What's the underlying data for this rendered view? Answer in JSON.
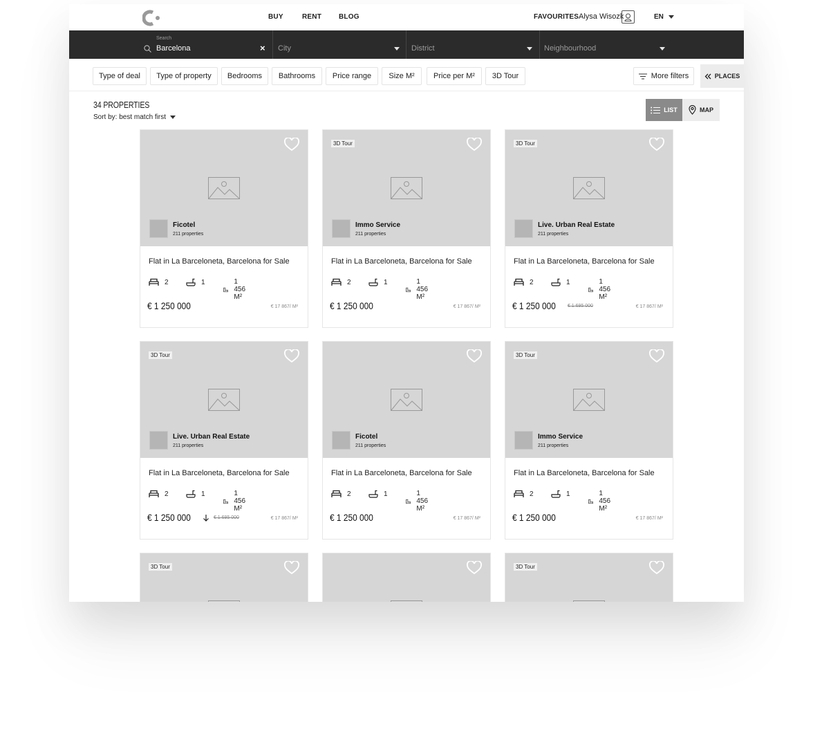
{
  "nav": {
    "links": [
      "BUY",
      "RENT",
      "BLOG"
    ],
    "favourites": "FAVOURITES",
    "user_name": "Alysa Wisozk",
    "language": "EN"
  },
  "search": {
    "label": "Search",
    "value": "Barcelona",
    "city_placeholder": "City",
    "district_placeholder": "District",
    "neighbourhood_placeholder": "Neighbourhood"
  },
  "filters": {
    "items": [
      "Type of deal",
      "Type of property",
      "Bedrooms",
      "Bathrooms",
      "Price range",
      "Size  M²",
      "Price per M²",
      "3D Tour"
    ],
    "more": "More filters",
    "places": "PLACES"
  },
  "results": {
    "count": "34 PROPERTIES",
    "sort": "Sort by: best match first",
    "list_label": "LIST",
    "map_label": "MAP"
  },
  "cards": [
    {
      "tour": "",
      "agency": "Ficotel",
      "agency_count": "211 properties",
      "title": "Flat in La Barceloneta, Barcelona for Sale",
      "beds": "2",
      "baths": "1",
      "size": "1 456 M²",
      "price": "€ 1 250 000",
      "old_price": "",
      "drop": false,
      "ppm": "€ 17 867/ M²"
    },
    {
      "tour": "3D Tour",
      "agency": "Immo Service",
      "agency_count": "211 properties",
      "title": "Flat in La Barceloneta, Barcelona for Sale",
      "beds": "2",
      "baths": "1",
      "size": "1 456 M²",
      "price": "€ 1 250 000",
      "old_price": "",
      "drop": false,
      "ppm": "€ 17 867/ M²"
    },
    {
      "tour": "3D Tour",
      "agency": "Live. Urban Real Estate",
      "agency_count": "211 properties",
      "title": "Flat in La Barceloneta, Barcelona for Sale",
      "beds": "2",
      "baths": "1",
      "size": "1 456 M²",
      "price": "€ 1 250 000",
      "old_price": "€ 1 695 000",
      "drop": false,
      "ppm": "€ 17 867/ M²"
    },
    {
      "tour": "3D Tour",
      "agency": "Live. Urban Real Estate",
      "agency_count": "211 properties",
      "title": "Flat in La Barceloneta, Barcelona for Sale",
      "beds": "2",
      "baths": "1",
      "size": "1 456 M²",
      "price": "€ 1 250 000",
      "old_price": "€ 1 695 000",
      "drop": true,
      "ppm": "€ 17 867/ M²"
    },
    {
      "tour": "",
      "agency": "Ficotel",
      "agency_count": "211 properties",
      "title": "Flat in La Barceloneta, Barcelona for Sale",
      "beds": "2",
      "baths": "1",
      "size": "1 456 M²",
      "price": "€ 1 250 000",
      "old_price": "",
      "drop": false,
      "ppm": "€ 17 867/ M²"
    },
    {
      "tour": "3D Tour",
      "agency": "Immo Service",
      "agency_count": "211 properties",
      "title": "Flat in La Barceloneta, Barcelona for Sale",
      "beds": "2",
      "baths": "1",
      "size": "1 456 M²",
      "price": "€ 1 250 000",
      "old_price": "",
      "drop": false,
      "ppm": "€ 17 867/ M²"
    },
    {
      "tour": "3D Tour"
    },
    {
      "tour": ""
    },
    {
      "tour": "3D Tour"
    }
  ]
}
